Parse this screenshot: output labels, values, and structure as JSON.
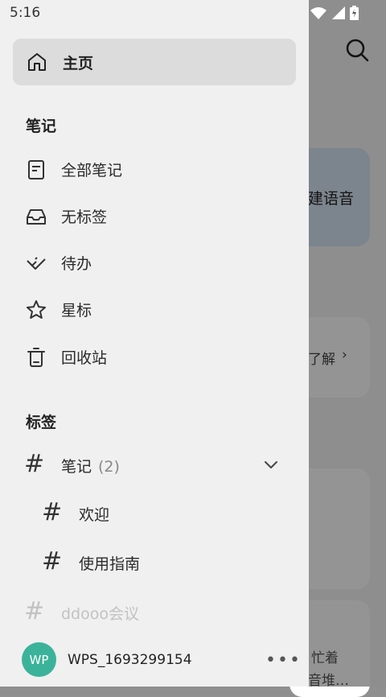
{
  "status_bar": {
    "time": "5:16"
  },
  "background": {
    "voice_card_text": "建语音",
    "learn_text": "了解",
    "learn_chevron": "›",
    "busy_line1": "忙着",
    "busy_line2": "音堆…"
  },
  "drawer": {
    "home": {
      "label": "主页",
      "icon": "home-icon"
    },
    "notes_section": {
      "title": "笔记",
      "items": [
        {
          "label": "全部笔记",
          "icon": "note-icon"
        },
        {
          "label": "无标签",
          "icon": "inbox-icon"
        },
        {
          "label": "待办",
          "icon": "todo-check-icon"
        },
        {
          "label": "星标",
          "icon": "star-icon"
        },
        {
          "label": "回收站",
          "icon": "trash-icon"
        }
      ]
    },
    "tags_section": {
      "title": "标签",
      "tags": [
        {
          "hash": "#",
          "label": "笔记",
          "count": "(2)"
        },
        {
          "hash": "#",
          "label": "欢迎"
        },
        {
          "hash": "#",
          "label": "使用指南"
        },
        {
          "hash": "#",
          "label": "ddooo会议"
        }
      ]
    },
    "account": {
      "avatar_text": "WP",
      "username": "WPS_1693299154",
      "more": "•••"
    }
  },
  "colors": {
    "drawer_bg": "#f0f0f0",
    "home_highlight": "#dcdcdc",
    "avatar_bg": "#3bb39a",
    "voice_card_bg": "#d6e4f3"
  }
}
